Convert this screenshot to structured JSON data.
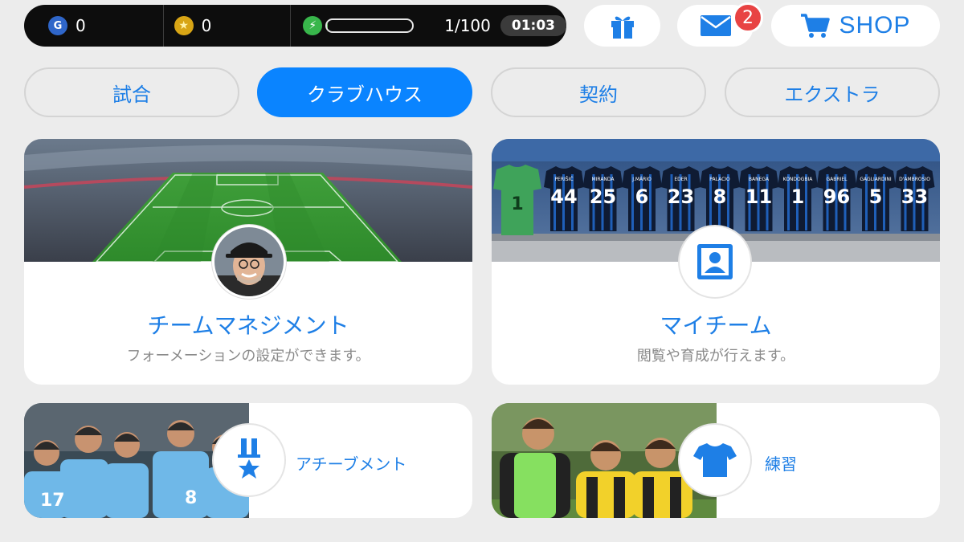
{
  "currency": {
    "gp": "0",
    "coins": "0",
    "energy_count": "1/100",
    "energy_fraction": 0.01,
    "timer": "01:03"
  },
  "header": {
    "mail_badge": "2",
    "shop_label": "SHOP"
  },
  "tabs": [
    {
      "label": "試合",
      "active": false
    },
    {
      "label": "クラブハウス",
      "active": true
    },
    {
      "label": "契約",
      "active": false
    },
    {
      "label": "エクストラ",
      "active": false
    }
  ],
  "cards": {
    "team_management": {
      "title": "チームマネジメント",
      "subtitle": "フォーメーションの設定ができます。"
    },
    "my_team": {
      "title": "マイチーム",
      "subtitle": "閲覧や育成が行えます。"
    },
    "achievement": {
      "label": "アチーブメント"
    },
    "training": {
      "label": "練習"
    }
  },
  "jerseys": [
    {
      "name": "PERIŠIĆ",
      "number": "44"
    },
    {
      "name": "MIRANDA",
      "number": "25"
    },
    {
      "name": "J.MÁRIO",
      "number": "6"
    },
    {
      "name": "EDER",
      "number": "23"
    },
    {
      "name": "PALACIO",
      "number": "8"
    },
    {
      "name": "BANEGA",
      "number": "11"
    },
    {
      "name": "KONDOGBIA",
      "number": "1"
    },
    {
      "name": "GABRIEL",
      "number": "96"
    },
    {
      "name": "GAGLIARDINI",
      "number": "5"
    },
    {
      "name": "D'AMBROSIO",
      "number": "33"
    }
  ],
  "colors": {
    "accent": "#0a84ff",
    "link": "#1e7fe6",
    "background": "#ececec",
    "badge": "#e84343"
  }
}
